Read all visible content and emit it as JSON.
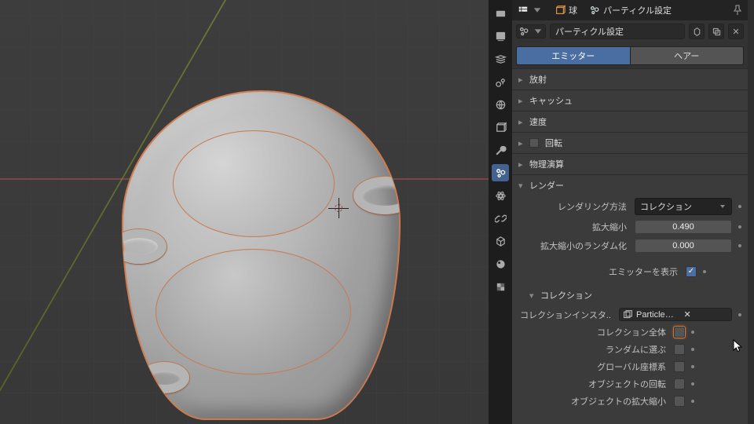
{
  "header": {
    "object_name": "球",
    "settings_name": "パーティクル設定"
  },
  "datablock": {
    "name": "パーティクル設定"
  },
  "tabs": {
    "emitter": "エミッター",
    "hair": "ヘアー"
  },
  "sections": {
    "emission": "放射",
    "cache": "キャッシュ",
    "velocity": "速度",
    "rotation": "回転",
    "physics": "物理演算",
    "render": "レンダー",
    "collection": "コレクション"
  },
  "render": {
    "render_as_label": "レンダリング方法",
    "render_as_value": "コレクション",
    "scale_label": "拡大縮小",
    "scale_value": "0.490",
    "scale_rand_label": "拡大縮小のランダム化",
    "scale_rand_value": "0.000",
    "show_emitter_label": "エミッターを表示"
  },
  "collection": {
    "instance_label": "コレクションインスタ..",
    "instance_value": "ParticleObjects",
    "whole_label": "コレクション全体",
    "pick_random_label": "ランダムに選ぶ",
    "global_label": "グローバル座標系",
    "obj_rotation_label": "オブジェクトの回転",
    "obj_scale_label": "オブジェクトの拡大縮小"
  }
}
